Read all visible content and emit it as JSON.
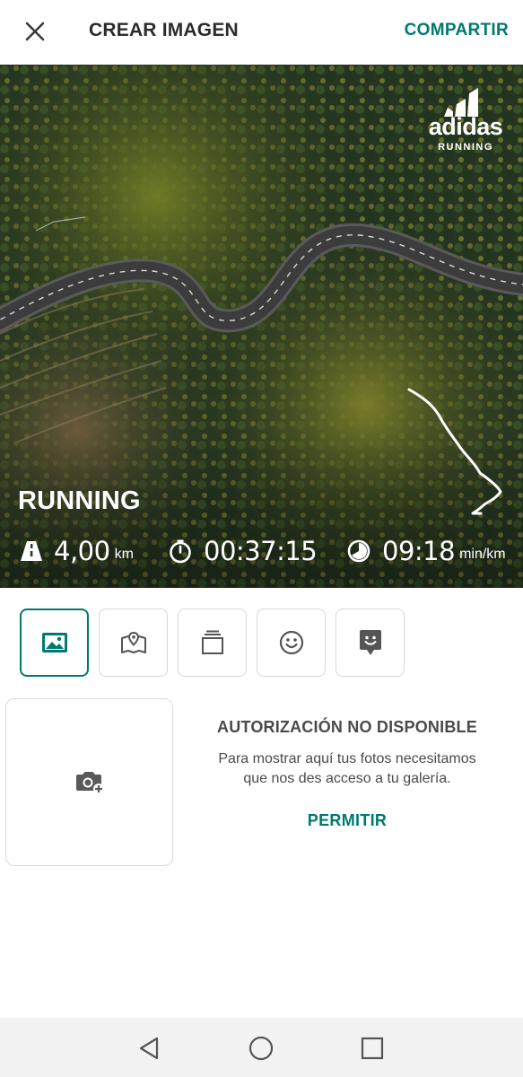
{
  "header": {
    "title": "CREAR IMAGEN",
    "share_label": "COMPARTIR",
    "close_icon": "close-icon"
  },
  "hero": {
    "brand": {
      "word": "adidas",
      "sub": "RUNNING"
    },
    "activity": "RUNNING",
    "stats": {
      "distance": {
        "icon": "road-icon",
        "value": "4,00",
        "unit": "km"
      },
      "duration": {
        "icon": "stopwatch-icon",
        "value": "00:37:15"
      },
      "pace": {
        "icon": "pace-icon",
        "value": "09:18",
        "unit": "min/km"
      }
    }
  },
  "tabs": [
    {
      "name": "image",
      "icon": "image-icon",
      "active": true
    },
    {
      "name": "map",
      "icon": "map-icon",
      "active": false
    },
    {
      "name": "frame",
      "icon": "layers-icon",
      "active": false
    },
    {
      "name": "emoji",
      "icon": "smiley-icon",
      "active": false
    },
    {
      "name": "sticker",
      "icon": "sticker-icon",
      "active": false
    }
  ],
  "gallery": {
    "add_photo_icon": "add-photo-icon",
    "title": "AUTORIZACIÓN NO DISPONIBLE",
    "line1": "Para mostrar aquí tus fotos necesitamos",
    "line2": "que nos des acceso a tu galería.",
    "button": "PERMITIR"
  },
  "colors": {
    "accent": "#00796f"
  }
}
